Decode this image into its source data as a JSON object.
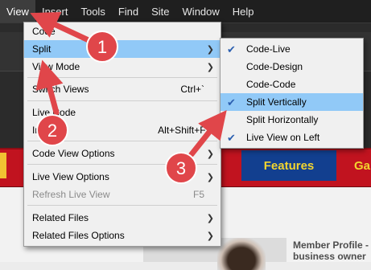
{
  "menubar": [
    "View",
    "Insert",
    "Tools",
    "Find",
    "Site",
    "Window",
    "Help"
  ],
  "view_menu": {
    "items": [
      {
        "label": "Code",
        "shortcut": "",
        "arrow": false
      },
      {
        "label": "Split",
        "shortcut": "",
        "arrow": true
      },
      {
        "label": "View Mode",
        "shortcut": "",
        "arrow": true
      },
      {
        "label": "Switch Views",
        "shortcut": "Ctrl+`",
        "arrow": false
      },
      {
        "label": "Live Code",
        "shortcut": "",
        "arrow": false
      },
      {
        "label": "In",
        "shortcut": "Alt+Shift+F11",
        "arrow": false
      },
      {
        "label": "Code View Options",
        "shortcut": "",
        "arrow": true
      },
      {
        "label": "Live View Options",
        "shortcut": "",
        "arrow": true
      },
      {
        "label": "Refresh Live View",
        "shortcut": "F5",
        "arrow": false
      },
      {
        "label": "Related Files",
        "shortcut": "",
        "arrow": true
      },
      {
        "label": "Related Files Options",
        "shortcut": "",
        "arrow": true
      }
    ],
    "highlighted": "Split",
    "disabled": "Refresh Live View"
  },
  "split_submenu": {
    "items": [
      {
        "label": "Code-Live",
        "checked": true
      },
      {
        "label": "Code-Design",
        "checked": false
      },
      {
        "label": "Code-Code",
        "checked": false
      },
      {
        "label": "Split Vertically",
        "checked": true
      },
      {
        "label": "Split Horizontally",
        "checked": false
      },
      {
        "label": "Live View on Left",
        "checked": true
      }
    ],
    "highlighted": "Split Vertically"
  },
  "callouts": [
    "1",
    "2",
    "3"
  ],
  "background": {
    "nav_button": "Features",
    "nav_partial": "Ga",
    "profile_text": [
      "Member Profile -",
      "business owner"
    ]
  },
  "colors": {
    "highlight": "#91c9f7",
    "callout": "#e0464a",
    "banner": "#c1131f",
    "nav_button": "#123f8f",
    "nav_text": "#f3d52f"
  },
  "icons": {
    "submenu_arrow": "chevron-right-icon",
    "check": "check-icon"
  }
}
